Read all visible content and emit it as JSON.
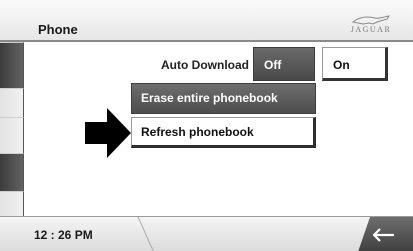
{
  "header": {
    "title": "Phone",
    "logo_text": "JAGUAR"
  },
  "settings": {
    "auto_download_label": "Auto Download",
    "off_label": "Off",
    "on_label": "On",
    "selected": "Off"
  },
  "actions": {
    "erase_label": "Erase entire phonebook",
    "refresh_label": "Refresh phonebook"
  },
  "footer": {
    "time": "12 : 26 PM"
  },
  "icons": {
    "logo": "jaguar-leaper-icon",
    "pointer": "arrow-right-icon",
    "back": "back-arrow-icon"
  },
  "colors": {
    "selected_button": "#4f4f4f",
    "accent_dark": "#333333"
  }
}
